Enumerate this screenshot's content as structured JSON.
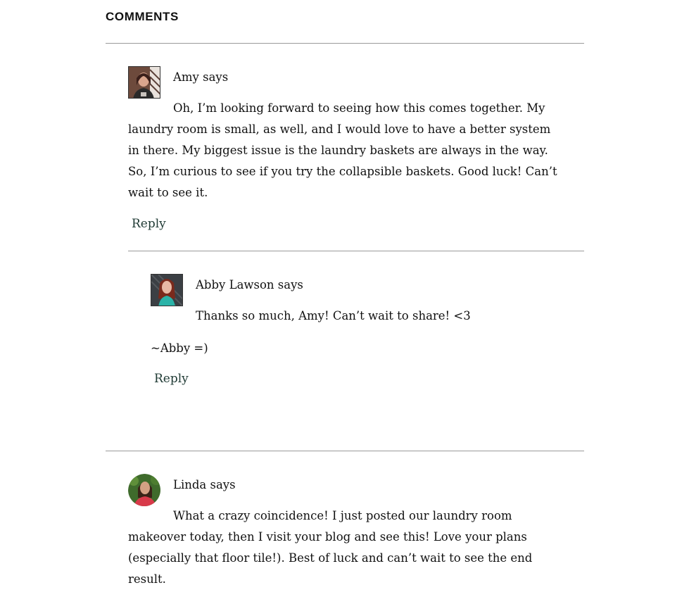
{
  "section": {
    "title": "COMMENTS"
  },
  "comments": [
    {
      "author": "Amy says",
      "text": "Oh, I’m looking forward to seeing how this comes together. My laundry room is small, as well, and I would love to have a better system in there. My biggest issue is the laundry baskets are always in the way. So, I’m curious to see if you try the collapsible baskets. Good luck! Can’t wait to see it.",
      "reply_label": "Reply"
    },
    {
      "author": "Abby Lawson says",
      "text": "Thanks so much, Amy! Can’t wait to share! <3",
      "signature": "~Abby =)",
      "reply_label": "Reply"
    },
    {
      "author": "Linda says",
      "text": "What a crazy coincidence! I just posted our laundry room makeover today, then I visit your blog and see this! Love your plans (especially that floor tile!). Best of luck and can’t wait to see the end result."
    }
  ],
  "colors": {
    "reply_link": "#1f3a34",
    "divider": "#9a9a9a"
  }
}
